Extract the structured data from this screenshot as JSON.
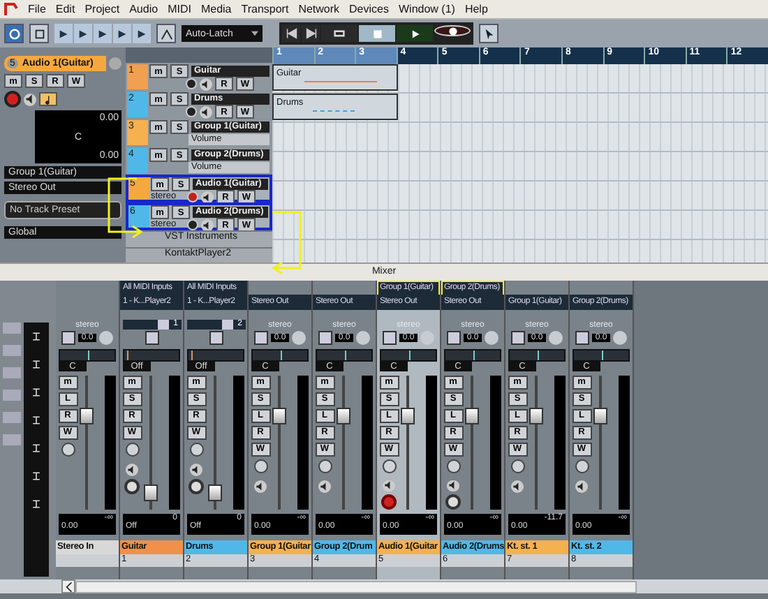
{
  "menu": [
    "File",
    "Edit",
    "Project",
    "Audio",
    "MIDI",
    "Media",
    "Transport",
    "Network",
    "Devices",
    "Window (1)",
    "Help"
  ],
  "toolbar": {
    "automation_mode": "Auto-Latch"
  },
  "inspector": {
    "track_number": "5",
    "track_name": "Audio 1(Guitar)",
    "color": "#f5a840",
    "buttons": [
      "m",
      "S",
      "R",
      "W"
    ],
    "record": true,
    "volume_reading": "0.00",
    "pan_label": "C",
    "pan_reading": "0.00",
    "input": "Group 1(Guitar)",
    "output": "Stereo Out",
    "preset_placeholder": "No Track Preset",
    "folder": "Global"
  },
  "tracks": [
    {
      "number": "1",
      "name": "Guitar",
      "kind": "midi",
      "color": "#f0a050",
      "selected": false,
      "record": false,
      "buttons": [
        "m",
        "S"
      ],
      "automation_buttons": [
        "R",
        "W"
      ]
    },
    {
      "number": "2",
      "name": "Drums",
      "kind": "midi",
      "color": "#50b8e8",
      "selected": false,
      "record": false,
      "buttons": [
        "m",
        "S"
      ],
      "automation_buttons": [
        "R",
        "W"
      ]
    },
    {
      "number": "3",
      "name": "Group 1(Guitar)",
      "kind": "group",
      "color": "#f5b050",
      "selected": false,
      "automation": "Volume",
      "buttons": [
        "m",
        "S"
      ]
    },
    {
      "number": "4",
      "name": "Group 2(Drums)",
      "kind": "group",
      "color": "#50b8e8",
      "selected": false,
      "automation": "Volume",
      "buttons": [
        "m",
        "S"
      ]
    },
    {
      "number": "5",
      "name": "Audio 1(Guitar)",
      "kind": "audio",
      "color": "#f5a840",
      "selected": true,
      "record": true,
      "channels": "stereo",
      "buttons": [
        "m",
        "S"
      ],
      "automation_buttons": [
        "R",
        "W"
      ]
    },
    {
      "number": "6",
      "name": "Audio 2(Drums)",
      "kind": "audio",
      "color": "#50b8e8",
      "selected": true,
      "record": false,
      "channels": "stereo",
      "buttons": [
        "m",
        "S"
      ],
      "automation_buttons": [
        "R",
        "W"
      ]
    }
  ],
  "folders": [
    {
      "name": "VST Instruments"
    },
    {
      "name": "KontaktPlayer2"
    }
  ],
  "ruler": [
    "1",
    "2",
    "3",
    "4",
    "5",
    "6",
    "7",
    "8",
    "9",
    "10",
    "11",
    "12"
  ],
  "parts": [
    {
      "label": "Guitar",
      "color": "#e08050",
      "kind": "line"
    },
    {
      "label": "Drums",
      "color": "#40a0e0",
      "kind": "dots"
    }
  ],
  "mixer": {
    "title": "Mixer",
    "channels": [
      {
        "name": "Stereo In",
        "kind": "input",
        "color": "#d8d8d8",
        "config": "stereo",
        "gain": "0.0",
        "buttons": [
          "m",
          "L",
          "R",
          "W"
        ],
        "pan_label": "C",
        "level": 0.7,
        "peak": "-∞",
        "value": "0.00",
        "selected": false
      },
      {
        "name": "Guitar",
        "kind": "midi",
        "color": "#f0904a",
        "number": "1",
        "input": "All MIDI Inputs",
        "output": "1 - K...Player2",
        "midi_channel": "1",
        "buttons": [
          "m",
          "S",
          "R",
          "W"
        ],
        "pan_label": "Off",
        "level": 0.12,
        "peak": "0",
        "value": "Off",
        "selected": false,
        "record": false
      },
      {
        "name": "Drums",
        "kind": "midi",
        "color": "#50b8e8",
        "number": "2",
        "input": "All MIDI Inputs",
        "output": "1 - K...Player2",
        "midi_channel": "2",
        "buttons": [
          "m",
          "S",
          "R",
          "W"
        ],
        "pan_label": "Off",
        "level": 0.12,
        "peak": "0",
        "value": "Off",
        "selected": false,
        "record": false
      },
      {
        "name": "Group 1(Guitar",
        "kind": "group",
        "color": "#f5b050",
        "number": "3",
        "output": "Stereo Out",
        "config": "stereo",
        "gain": "0.0",
        "buttons": [
          "m",
          "S",
          "L",
          "R",
          "W"
        ],
        "pan_label": "C",
        "level": 0.7,
        "peak": "-∞",
        "value": "0.00",
        "selected": false
      },
      {
        "name": "Group 2(Drum",
        "kind": "group",
        "color": "#50b8e8",
        "number": "4",
        "output": "Stereo Out",
        "config": "stereo",
        "gain": "0.0",
        "buttons": [
          "m",
          "S",
          "L",
          "R",
          "W"
        ],
        "pan_label": "C",
        "level": 0.7,
        "peak": "-∞",
        "value": "0.00",
        "selected": false
      },
      {
        "name": "Audio 1(Guitar",
        "kind": "audio",
        "color": "#f5b050",
        "number": "5",
        "input": "Group 1(Guitar)",
        "input_highlighted": true,
        "output": "Stereo Out",
        "config": "stereo",
        "gain": "0.0",
        "buttons": [
          "m",
          "S",
          "L",
          "R",
          "W"
        ],
        "pan_label": "C",
        "level": 0.7,
        "peak": "-∞",
        "value": "0.00",
        "selected": true,
        "record": true
      },
      {
        "name": "Audio 2(Drums",
        "kind": "audio",
        "color": "#50b8e8",
        "number": "6",
        "input": "Group 2(Drums)",
        "input_highlighted": true,
        "output": "Stereo Out",
        "config": "stereo",
        "gain": "0.0",
        "buttons": [
          "m",
          "S",
          "L",
          "R",
          "W"
        ],
        "pan_label": "C",
        "level": 0.7,
        "peak": "-∞",
        "value": "0.00",
        "selected": false,
        "record": false
      },
      {
        "name": "Kt. st. 1",
        "kind": "instrument",
        "color": "#f5b050",
        "number": "7",
        "output": "Group 1(Guitar)",
        "config": "stereo",
        "gain": "0.0",
        "buttons": [
          "m",
          "S",
          "L",
          "R",
          "W"
        ],
        "pan_label": "C",
        "level": 0.7,
        "peak": "-11.7",
        "value": "0.00",
        "selected": false
      },
      {
        "name": "Kt. st. 2",
        "kind": "instrument",
        "color": "#50b8e8",
        "number": "8",
        "output": "Group 2(Drums)",
        "config": "stereo",
        "gain": "0.0",
        "buttons": [
          "m",
          "S",
          "L",
          "R",
          "W"
        ],
        "pan_label": "C",
        "level": 0.7,
        "peak": "-∞",
        "value": "0.00",
        "selected": false
      }
    ]
  }
}
